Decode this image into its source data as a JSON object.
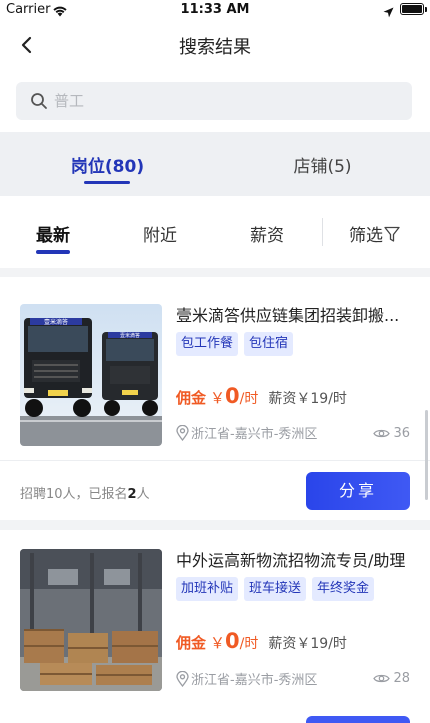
{
  "status_bar": {
    "carrier": "Carrier",
    "time": "11:33 AM"
  },
  "nav": {
    "title": "搜索结果"
  },
  "search": {
    "placeholder": "普工"
  },
  "main_tabs": [
    {
      "label": "岗位(80)",
      "active": true
    },
    {
      "label": "店铺(5)",
      "active": false
    }
  ],
  "filters": [
    {
      "label": "最新",
      "active": true
    },
    {
      "label": "附近",
      "active": false
    },
    {
      "label": "薪资",
      "active": false
    },
    {
      "label": "筛选",
      "active": false,
      "icon": "funnel-icon"
    }
  ],
  "jobs": [
    {
      "title": "壹米滴答供应链集团招装卸搬...",
      "tags": [
        "包工作餐",
        "包住宿"
      ],
      "commission_label": "佣金",
      "commission_currency": "￥",
      "commission_value": "0",
      "commission_unit": "/时",
      "salary": "薪资￥19/时",
      "location": "浙江省-嘉兴市-秀洲区",
      "views": "36",
      "footer_prefix": "招聘10人，已报名",
      "footer_count": "2",
      "footer_suffix": "人",
      "share_label": "分享",
      "image": "trucks-photo",
      "truck_signs": [
        "壹米滴答",
        "壹米滴答"
      ]
    },
    {
      "title": "中外运高新物流招物流专员/助理",
      "tags": [
        "加班补贴",
        "班车接送",
        "年终奖金"
      ],
      "commission_label": "佣金",
      "commission_currency": "￥",
      "commission_value": "0",
      "commission_unit": "/时",
      "salary": "薪资￥19/时",
      "location": "浙江省-嘉兴市-秀洲区",
      "views": "28",
      "image": "warehouse-photo"
    }
  ],
  "colors": {
    "accent": "#2336b8",
    "commission": "#f05a24",
    "tag_bg": "#e4eaff",
    "share_button": "#3f59f4"
  }
}
